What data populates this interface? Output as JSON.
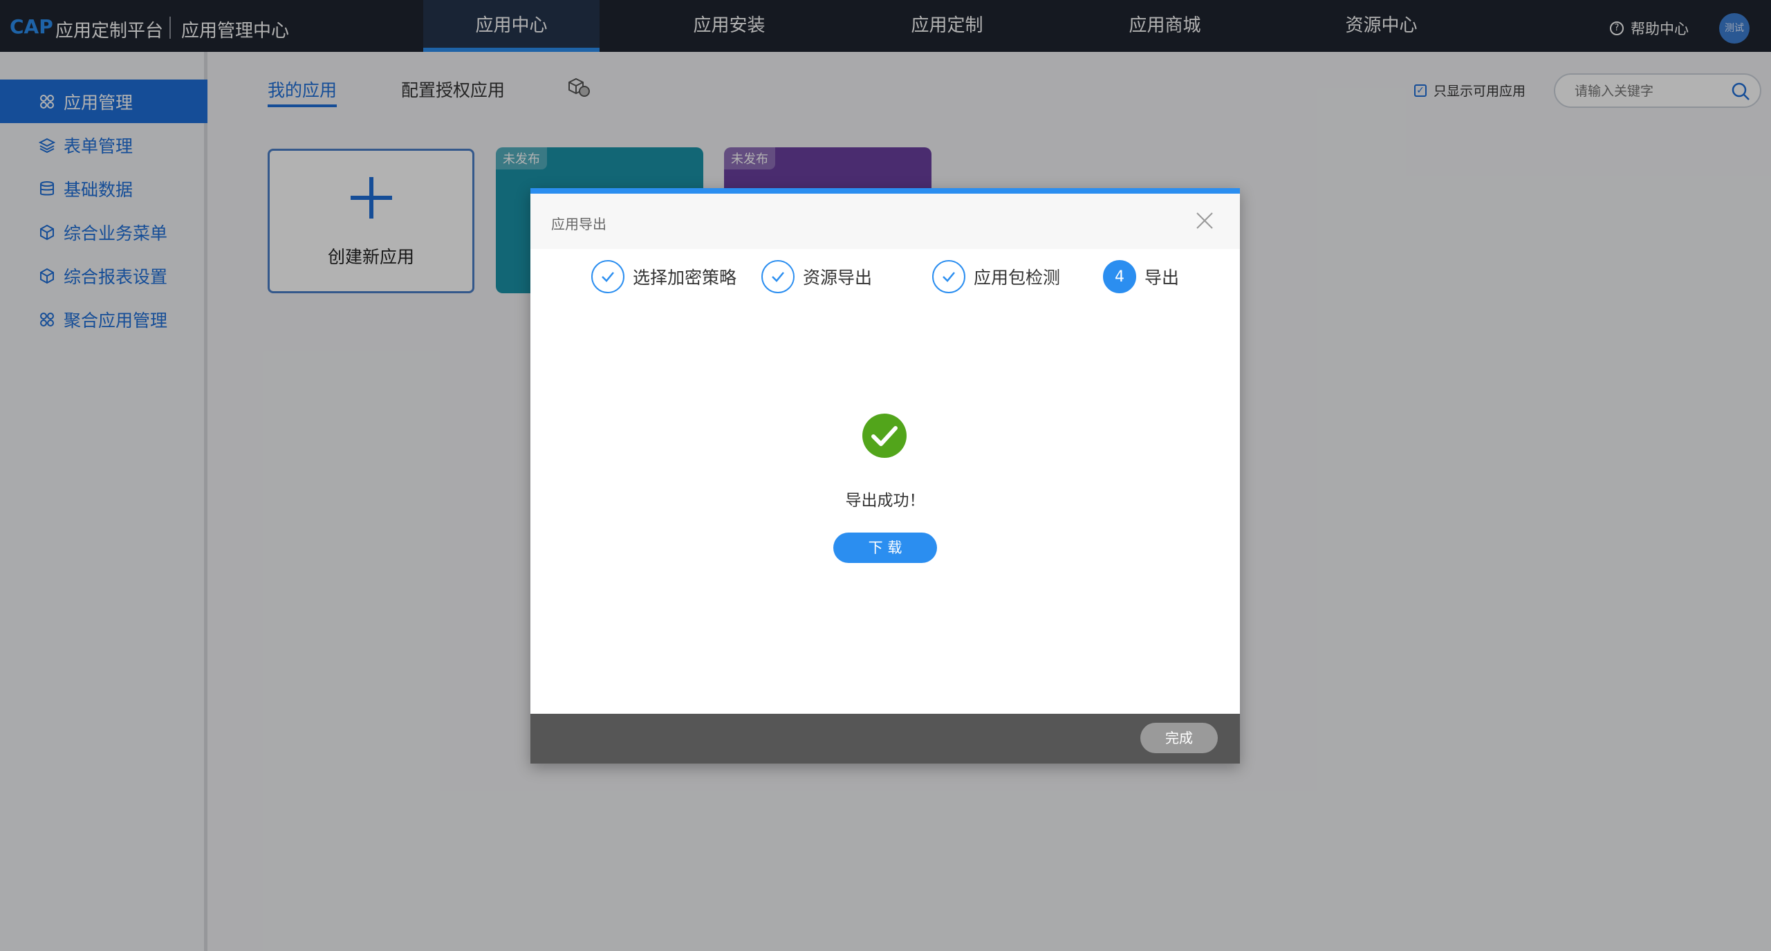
{
  "header": {
    "brand_cap": "CAP",
    "brand_name": "应用定制平台",
    "brand_sub": "应用管理中心",
    "nav_tabs": [
      {
        "label": "应用中心"
      },
      {
        "label": "应用安装"
      },
      {
        "label": "应用定制"
      },
      {
        "label": "应用商城"
      },
      {
        "label": "资源中心"
      }
    ],
    "active_tab": "应用中心",
    "help_label": "帮助中心",
    "avatar_label": "测试"
  },
  "sidebar": {
    "items": [
      {
        "label": "应用管理",
        "icon": "apps-grid-icon"
      },
      {
        "label": "表单管理",
        "icon": "layers-icon"
      },
      {
        "label": "基础数据",
        "icon": "database-icon"
      },
      {
        "label": "综合业务菜单",
        "icon": "cube-icon"
      },
      {
        "label": "综合报表设置",
        "icon": "cube-icon"
      },
      {
        "label": "聚合应用管理",
        "icon": "apps-grid-icon"
      }
    ],
    "active_item": "应用管理"
  },
  "main": {
    "subtabs": [
      {
        "label": "我的应用"
      },
      {
        "label": "配置授权应用"
      }
    ],
    "active_subtab": "我的应用",
    "filter_label": "只显示可用应用",
    "filter_checked": true,
    "search_placeholder": "请输入关键字",
    "create_card_label": "创建新应用",
    "app_cards": [
      {
        "badge": "未发布",
        "color": "#1a93a8"
      },
      {
        "badge": "未发布",
        "color": "#6a3fa0"
      }
    ]
  },
  "modal": {
    "title": "应用导出",
    "steps": [
      {
        "label": "选择加密策略",
        "status": "done"
      },
      {
        "label": "资源导出",
        "status": "done"
      },
      {
        "label": "应用包检测",
        "status": "done"
      },
      {
        "label": "导出",
        "status": "current",
        "number": "4"
      }
    ],
    "success_text": "导出成功！",
    "download_label": "下 载",
    "finish_label": "完成"
  },
  "colors": {
    "accent": "#2b8ef0",
    "topbar": "#1f2430",
    "success": "#52a51b"
  }
}
